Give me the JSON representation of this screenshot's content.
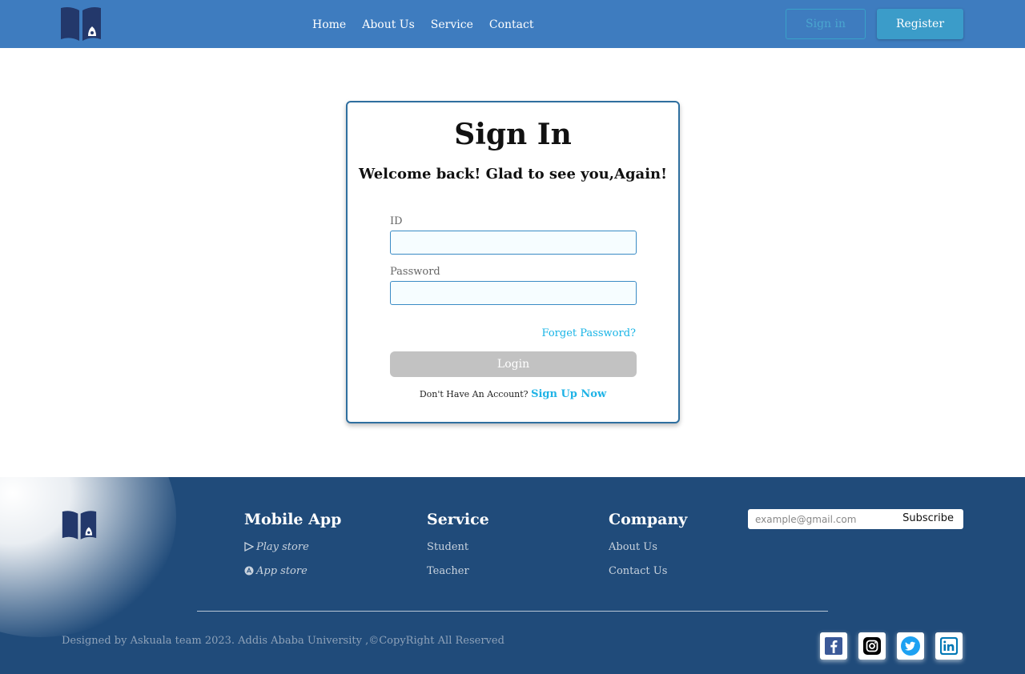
{
  "header": {
    "nav": [
      "Home",
      "About Us",
      "Service",
      "Contact"
    ],
    "signin_label": "Sign in",
    "register_label": "Register"
  },
  "login": {
    "title": "Sign In",
    "subtitle": "Welcome back! Glad to see you,Again!",
    "id_label": "ID",
    "id_value": "",
    "password_label": "Password",
    "password_value": "",
    "forgot_label": "Forget Password?",
    "login_label": "Login",
    "no_account_text": "Don't Have An Account?",
    "signup_label": "Sign Up Now"
  },
  "footer": {
    "mobile_app": {
      "title": "Mobile App",
      "items": [
        "Play store",
        "App store"
      ]
    },
    "service": {
      "title": "Service",
      "items": [
        "Student",
        "Teacher"
      ]
    },
    "company": {
      "title": "Company",
      "items": [
        "About Us",
        "Contact Us"
      ]
    },
    "subscribe": {
      "placeholder": "example@gmail.com",
      "button_label": "Subscribe"
    },
    "copyright": "Designed by Askuala team 2023. Addis Ababa University ,©CopyRight All Reserved",
    "social_icons": [
      "facebook-icon",
      "instagram-icon",
      "twitter-icon",
      "linkedin-icon"
    ]
  },
  "colors": {
    "header_bg": "#3e7cbf",
    "footer_bg": "#204b7a",
    "accent": "#1fb3e6",
    "logo": "#23386b"
  }
}
